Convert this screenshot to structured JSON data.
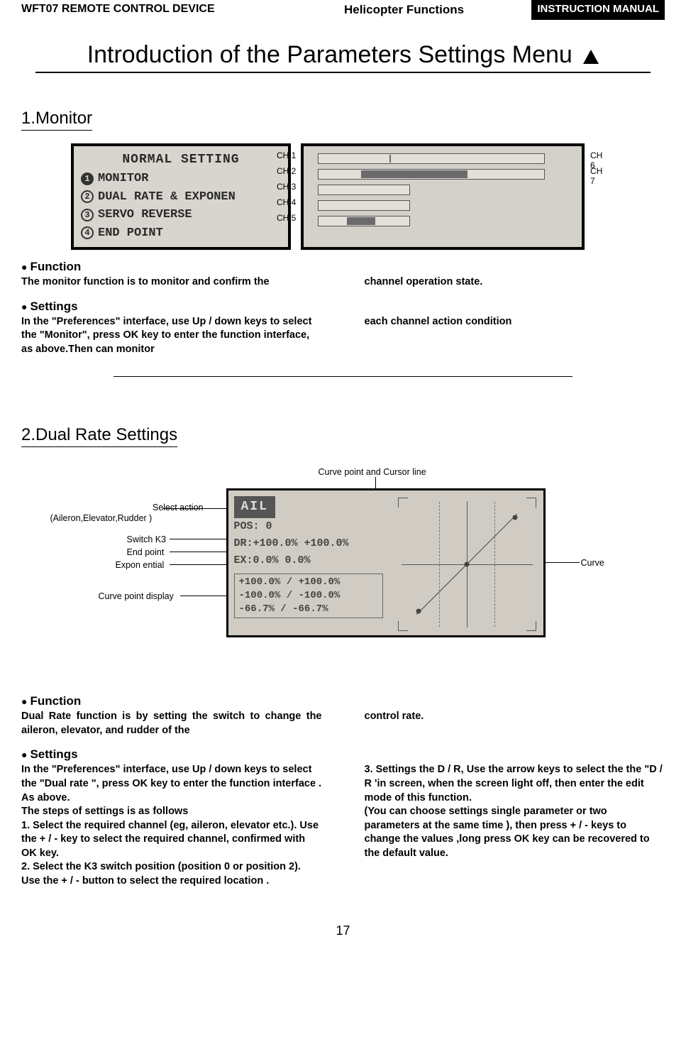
{
  "header": {
    "product": "WFT07 REMOTE CONTROL DEVICE",
    "section": "Helicopter Functions",
    "manual": "INSTRUCTION MANUAL"
  },
  "page_title": "Introduction of the Parameters Settings Menu",
  "monitor": {
    "heading": "1.Monitor",
    "lcd": {
      "title": "NORMAL SETTING",
      "items": [
        "MONITOR",
        "DUAL RATE & EXPONEN",
        "SERVO REVERSE",
        "END POINT"
      ]
    },
    "channels": {
      "left": [
        "CH 1",
        "CH 2",
        "CH 3",
        "CH 4",
        "CH 5"
      ],
      "right": [
        "CH 6",
        "CH 7"
      ]
    },
    "function_label": "Function",
    "function_text_left": "The monitor function is to monitor and confirm the",
    "function_text_right": "channel operation state.",
    "settings_label": "Settings",
    "settings_text_left": "In the \"Preferences\" interface, use Up / down keys to select the \"Monitor\", press OK key to enter the function interface, as above.Then can monitor",
    "settings_text_right": "each channel action condition"
  },
  "dualrate": {
    "heading": "2.Dual Rate Settings",
    "callouts": {
      "top": "Curve point and Cursor line",
      "select": "Select action",
      "select_sub": "(Aileron,Elevator,Rudder )",
      "switch": "Switch K3",
      "endpoint": "End point",
      "expo": "Expon ential",
      "cpd": "Curve point display",
      "curve": "Curve"
    },
    "lcd": {
      "ail": "AIL",
      "pos": "POS: 0",
      "dr": "DR:+100.0%  +100.0%",
      "ex": "EX:0.0%    0.0%",
      "curve_rows": [
        "+100.0% / +100.0%",
        "-100.0% / -100.0%",
        " -66.7% /  -66.7%"
      ]
    },
    "function_label": "Function",
    "function_text_left": "Dual Rate function is by setting the switch to change the aileron, elevator, and rudder of the",
    "function_text_right": "control rate.",
    "settings_label": "Settings",
    "settings_text_left": "In the \"Preferences\" interface, use Up / down keys to select the \"Dual rate \", press OK key to enter the function interface . As above.\nThe steps of settings is as follows\n1. Select the required channel (eg, aileron, elevator etc.). Use the + / - key to select the required channel, confirmed with OK key.\n2. Select the K3 switch position (position 0 or position 2). Use the + / - button to select the required location .",
    "settings_text_right": "3. Settings the D / R, Use the arrow keys to select the the \"D / R 'in screen, when the screen light off, then enter the edit mode of this function.\n(You can choose settings single parameter or two parameters at the same time ), then press + / - keys to change the values ,long press OK key can be recovered to the default value."
  },
  "page_number": "17"
}
